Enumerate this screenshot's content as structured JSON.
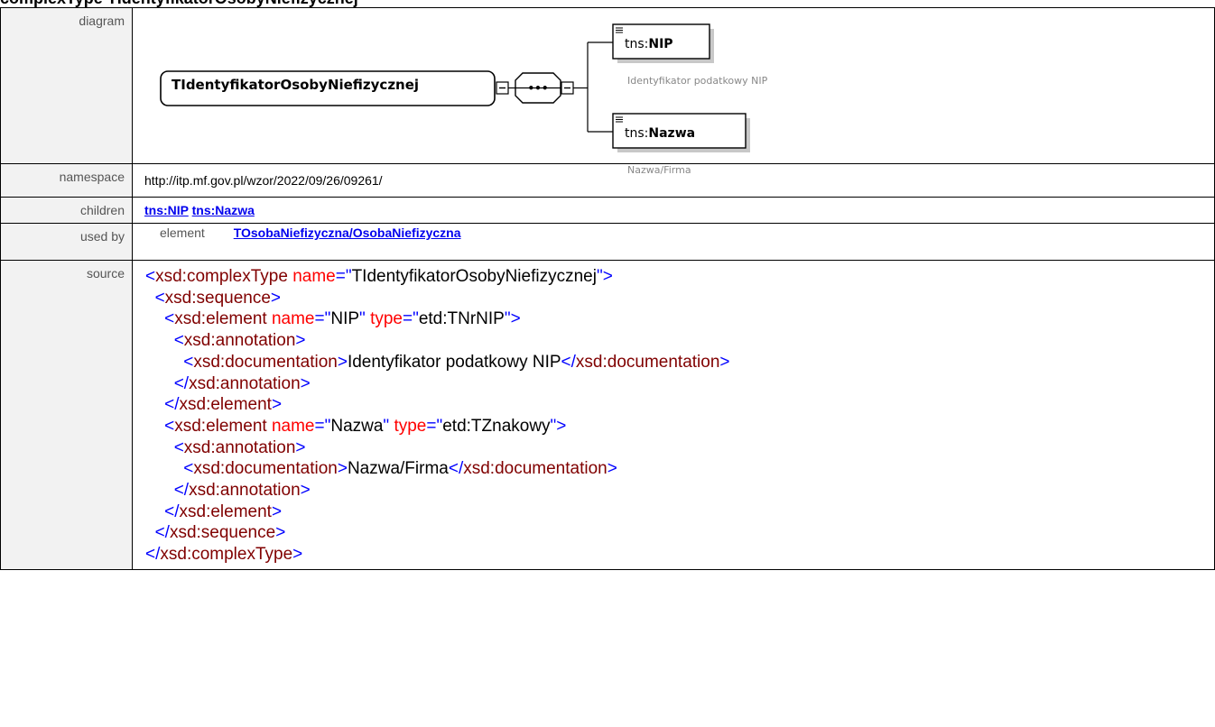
{
  "title": "complexType TIdentyfikatorOsobyNiefizycznej",
  "labels": {
    "diagram": "diagram",
    "namespace": "namespace",
    "children": "children",
    "used_by": "used by",
    "source": "source"
  },
  "diagram": {
    "root": "TIdentyfikatorOsobyNiefizycznej",
    "sequence_symbol": "•••",
    "elements": [
      {
        "prefix": "tns:",
        "name": "NIP",
        "doc": "Identyfikator podatkowy NIP"
      },
      {
        "prefix": "tns:",
        "name": "Nazwa",
        "doc": "Nazwa/Firma"
      }
    ]
  },
  "namespace": "http://itp.mf.gov.pl/wzor/2022/09/26/09261/",
  "children": [
    "tns:NIP",
    "tns:Nazwa"
  ],
  "used_by": {
    "kind": "element",
    "link": "TOsobaNiefizyczna/OsobaNiefizyczna"
  },
  "source_lines": [
    [
      [
        "tag",
        "<"
      ],
      [
        "tagname",
        "xsd:complexType"
      ],
      [
        "txt",
        " "
      ],
      [
        "attr",
        "name"
      ],
      [
        "tag",
        "=\""
      ],
      [
        "attrval",
        "TIdentyfikatorOsobyNiefizycznej"
      ],
      [
        "tag",
        "\">"
      ]
    ],
    [
      [
        "txt",
        "  "
      ],
      [
        "tag",
        "<"
      ],
      [
        "tagname",
        "xsd:sequence"
      ],
      [
        "tag",
        ">"
      ]
    ],
    [
      [
        "txt",
        "    "
      ],
      [
        "tag",
        "<"
      ],
      [
        "tagname",
        "xsd:element"
      ],
      [
        "txt",
        " "
      ],
      [
        "attr",
        "name"
      ],
      [
        "tag",
        "=\""
      ],
      [
        "attrval",
        "NIP"
      ],
      [
        "tag",
        "\""
      ],
      [
        "txt",
        " "
      ],
      [
        "attr",
        "type"
      ],
      [
        "tag",
        "=\""
      ],
      [
        "attrval",
        "etd:TNrNIP"
      ],
      [
        "tag",
        "\">"
      ]
    ],
    [
      [
        "txt",
        "      "
      ],
      [
        "tag",
        "<"
      ],
      [
        "tagname",
        "xsd:annotation"
      ],
      [
        "tag",
        ">"
      ]
    ],
    [
      [
        "txt",
        "        "
      ],
      [
        "tag",
        "<"
      ],
      [
        "tagname",
        "xsd:documentation"
      ],
      [
        "tag",
        ">"
      ],
      [
        "txt",
        "Identyfikator podatkowy NIP"
      ],
      [
        "tag",
        "</"
      ],
      [
        "tagname",
        "xsd:documentation"
      ],
      [
        "tag",
        ">"
      ]
    ],
    [
      [
        "txt",
        "      "
      ],
      [
        "tag",
        "</"
      ],
      [
        "tagname",
        "xsd:annotation"
      ],
      [
        "tag",
        ">"
      ]
    ],
    [
      [
        "txt",
        "    "
      ],
      [
        "tag",
        "</"
      ],
      [
        "tagname",
        "xsd:element"
      ],
      [
        "tag",
        ">"
      ]
    ],
    [
      [
        "txt",
        "    "
      ],
      [
        "tag",
        "<"
      ],
      [
        "tagname",
        "xsd:element"
      ],
      [
        "txt",
        " "
      ],
      [
        "attr",
        "name"
      ],
      [
        "tag",
        "=\""
      ],
      [
        "attrval",
        "Nazwa"
      ],
      [
        "tag",
        "\""
      ],
      [
        "txt",
        " "
      ],
      [
        "attr",
        "type"
      ],
      [
        "tag",
        "=\""
      ],
      [
        "attrval",
        "etd:TZnakowy"
      ],
      [
        "tag",
        "\">"
      ]
    ],
    [
      [
        "txt",
        "      "
      ],
      [
        "tag",
        "<"
      ],
      [
        "tagname",
        "xsd:annotation"
      ],
      [
        "tag",
        ">"
      ]
    ],
    [
      [
        "txt",
        "        "
      ],
      [
        "tag",
        "<"
      ],
      [
        "tagname",
        "xsd:documentation"
      ],
      [
        "tag",
        ">"
      ],
      [
        "txt",
        "Nazwa/Firma"
      ],
      [
        "tag",
        "</"
      ],
      [
        "tagname",
        "xsd:documentation"
      ],
      [
        "tag",
        ">"
      ]
    ],
    [
      [
        "txt",
        "      "
      ],
      [
        "tag",
        "</"
      ],
      [
        "tagname",
        "xsd:annotation"
      ],
      [
        "tag",
        ">"
      ]
    ],
    [
      [
        "txt",
        "    "
      ],
      [
        "tag",
        "</"
      ],
      [
        "tagname",
        "xsd:element"
      ],
      [
        "tag",
        ">"
      ]
    ],
    [
      [
        "txt",
        "  "
      ],
      [
        "tag",
        "</"
      ],
      [
        "tagname",
        "xsd:sequence"
      ],
      [
        "tag",
        ">"
      ]
    ],
    [
      [
        "tag",
        "</"
      ],
      [
        "tagname",
        "xsd:complexType"
      ],
      [
        "tag",
        ">"
      ]
    ]
  ]
}
